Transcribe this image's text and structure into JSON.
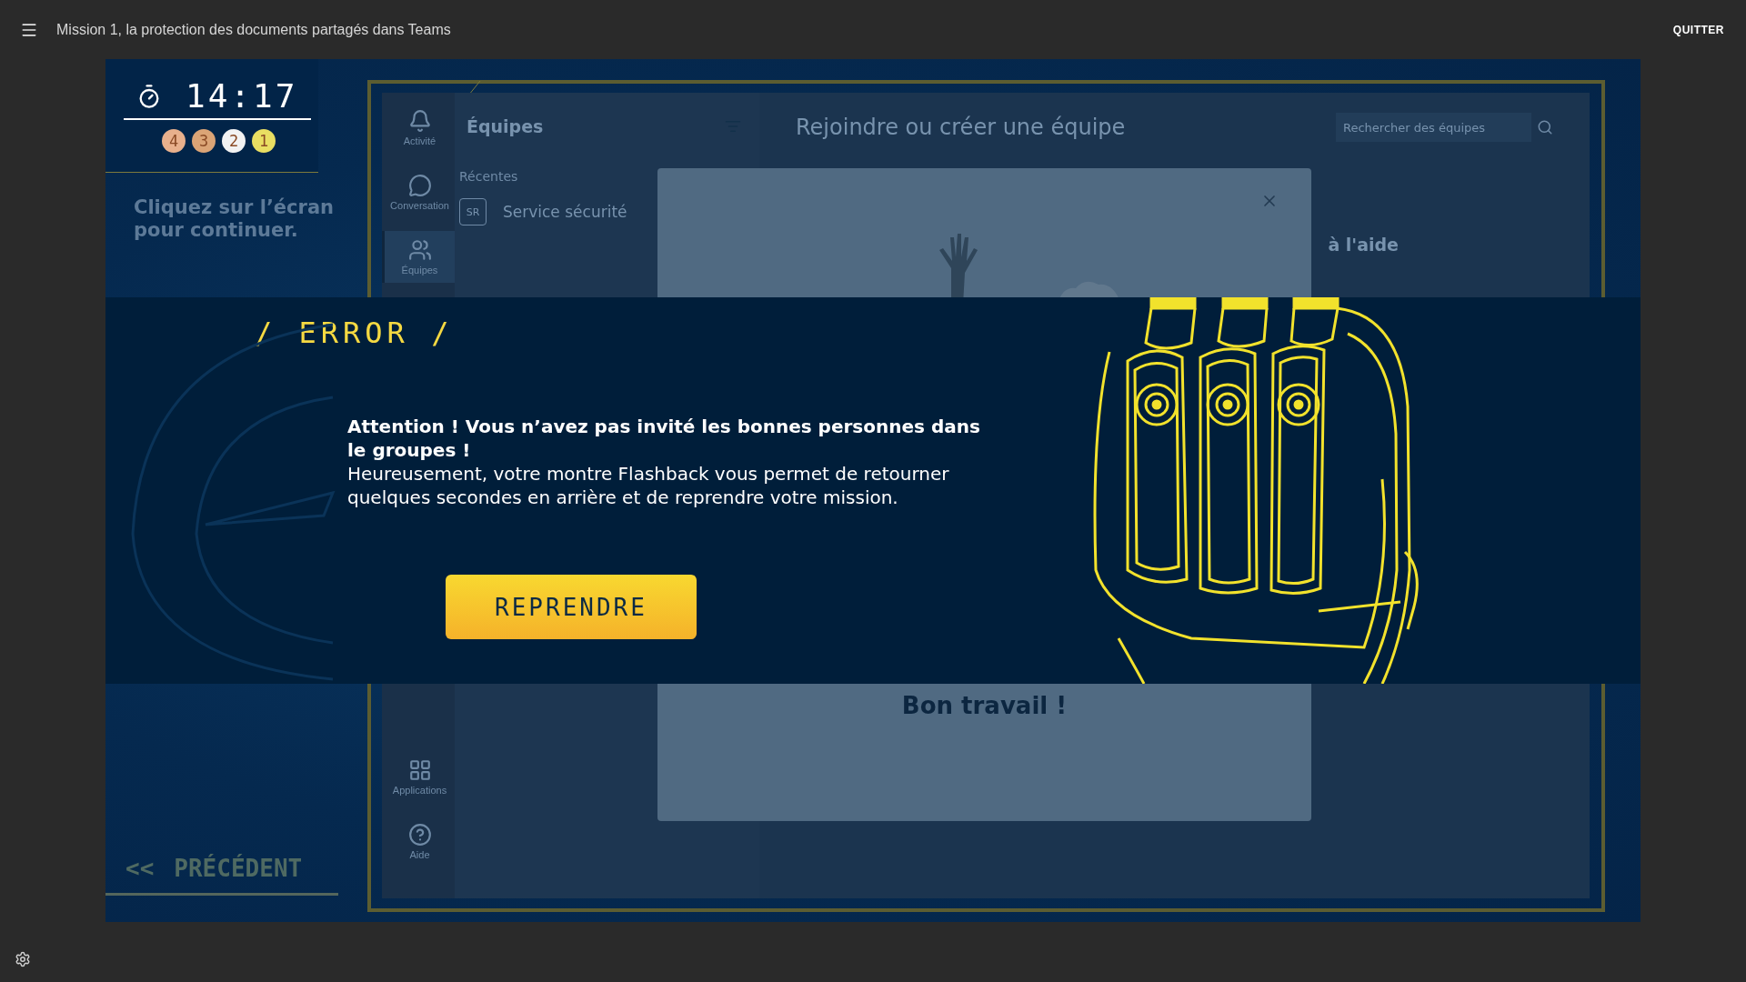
{
  "top_bar": {
    "title": "Mission 1, la protection des documents partagés dans Teams",
    "quit": "QUITTER"
  },
  "timer": {
    "time": "14:17",
    "medals": [
      {
        "label": "4",
        "color": "#e8b08c"
      },
      {
        "label": "3",
        "color": "#dba476"
      },
      {
        "label": "2",
        "color": "#f2f2f2"
      },
      {
        "label": "1",
        "color": "#e9de62"
      }
    ]
  },
  "hint": "Cliquez sur l’écran pour continuer.",
  "previous": {
    "arrow": "<<",
    "label": "PRÉCÉDENT"
  },
  "teams": {
    "rail": [
      {
        "kind": "bell",
        "label": "Activité",
        "selected": false
      },
      {
        "kind": "chat",
        "label": "Conversation",
        "selected": false
      },
      {
        "kind": "teams",
        "label": "Équipes",
        "selected": true
      }
    ],
    "rail_bottom": [
      {
        "kind": "apps",
        "label": "Applications",
        "selected": false
      },
      {
        "kind": "help",
        "label": "Aide",
        "selected": false
      }
    ],
    "panel_title": "Équipes",
    "section": "Récentes",
    "team": {
      "initials": "SR",
      "name": "Service sécurité"
    },
    "main_title": "Rejoindre ou créer une équipe",
    "search": {
      "placeholder": "Rechercher des équipes"
    },
    "side_text": "à l'aide",
    "dialog": {
      "title": "Bon travail !"
    }
  },
  "error": {
    "heading": "/ ERROR /",
    "alert": "Attention ! Vous n’avez pas invité les bonnes personnes dans le groupes !",
    "body": "Heureusement, votre montre Flashback vous permet de retourner quelques secondes en arrière et de reprendre votre mission.",
    "button": "REPRENDRE"
  }
}
